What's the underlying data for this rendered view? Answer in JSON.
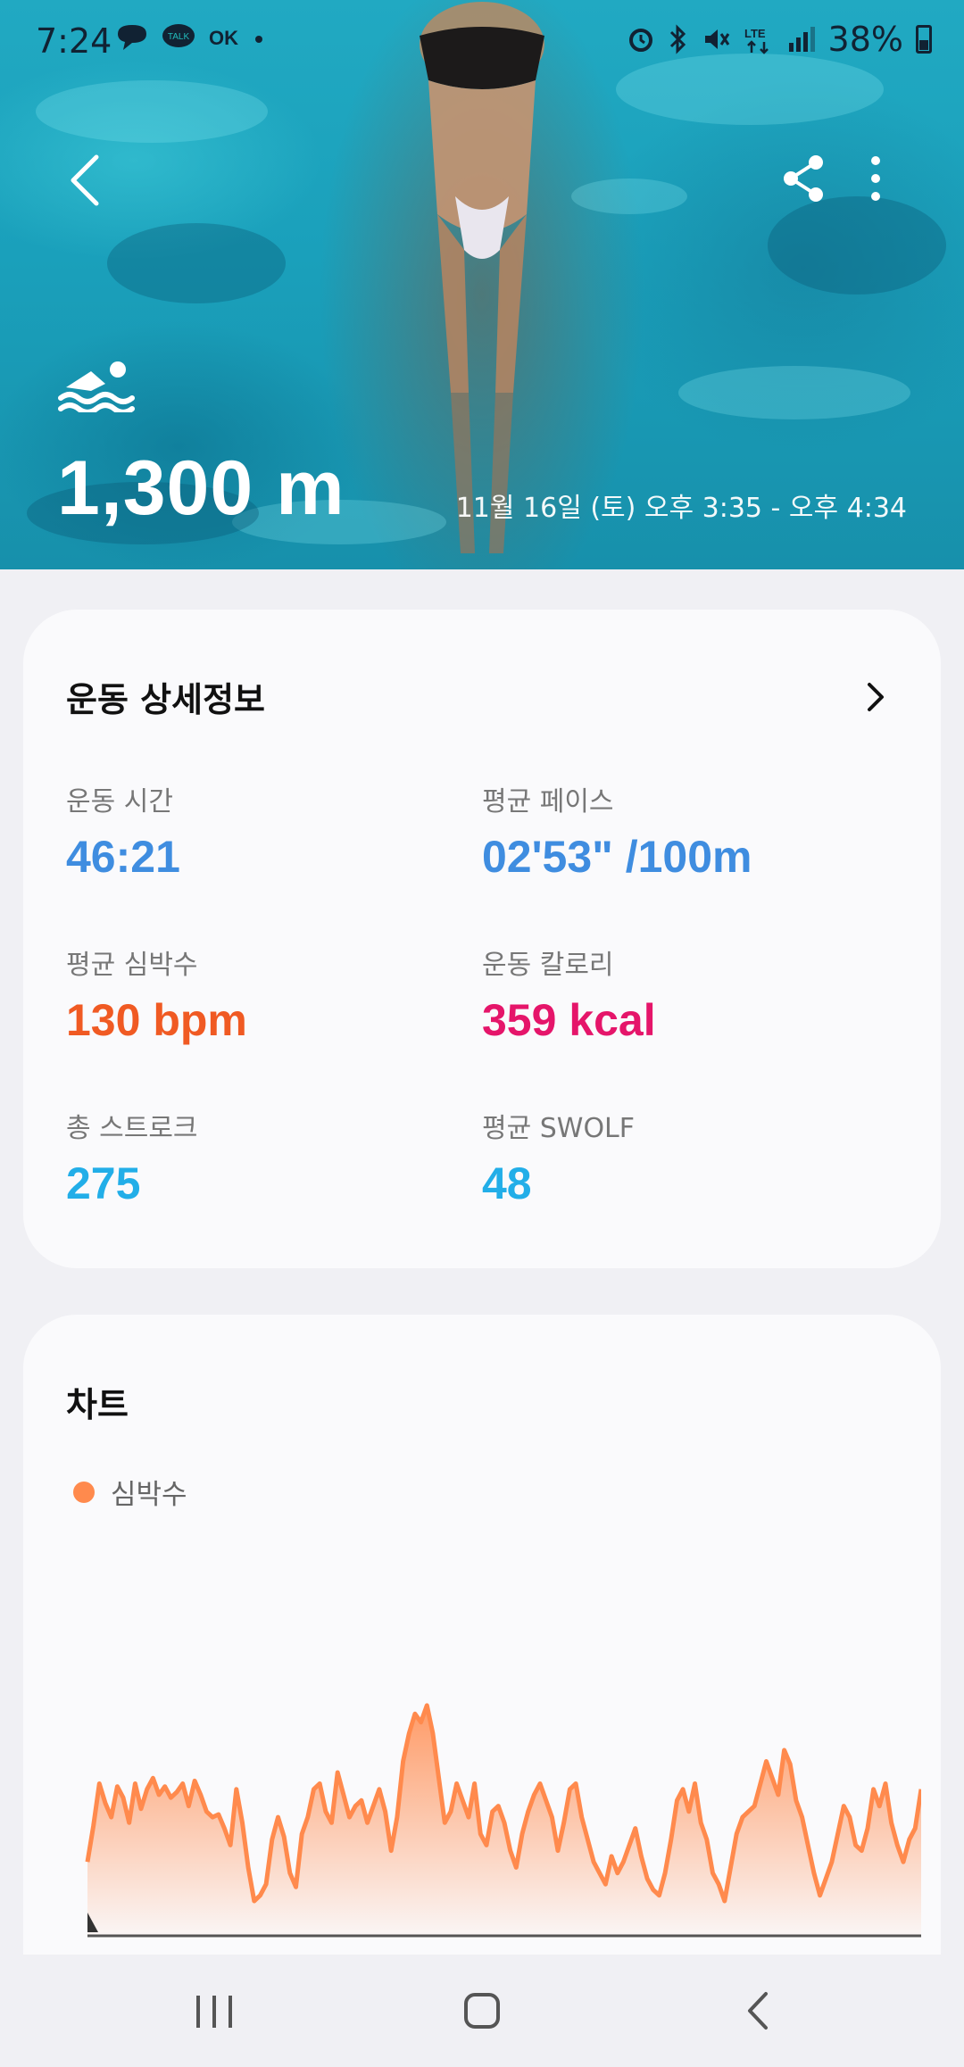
{
  "status_bar": {
    "time": "7:24",
    "left_icons": [
      "chat-bubble-icon",
      "talk-icon",
      "ok-icon",
      "dot-icon"
    ],
    "right_icons": [
      "alarm-icon",
      "bluetooth-icon",
      "mute-icon",
      "lte-icon",
      "signal-icon"
    ],
    "battery_text": "38%"
  },
  "header": {
    "distance": "1,300 m",
    "date_range": "11월 16일 (토) 오후 3:35 - 오후 4:34",
    "activity_icon": "swimming-icon"
  },
  "details": {
    "title": "운동 상세정보",
    "metrics": [
      {
        "label": "운동 시간",
        "value": "46:21",
        "color": "#3f8de0"
      },
      {
        "label": "평균 페이스",
        "value": "02'53\" /100m",
        "color": "#3f8de0"
      },
      {
        "label": "평균 심박수",
        "value": "130 bpm",
        "color": "#f05a23"
      },
      {
        "label": "운동 칼로리",
        "value": "359 kcal",
        "color": "#e5156a"
      },
      {
        "label": "총 스트로크",
        "value": "275",
        "color": "#22aee8"
      },
      {
        "label": "평균 SWOLF",
        "value": "48",
        "color": "#22aee8"
      }
    ]
  },
  "chart_section": {
    "title": "차트",
    "legend_label": "심박수",
    "accent": "#ff8a4d"
  },
  "chart_data": {
    "type": "area",
    "title": "",
    "series": [
      {
        "name": "심박수",
        "values": [
          112,
          125,
          140,
          133,
          128,
          139,
          135,
          126,
          140,
          131,
          138,
          142,
          136,
          139,
          135,
          137,
          140,
          132,
          141,
          136,
          130,
          128,
          129,
          124,
          118,
          138,
          126,
          110,
          98,
          100,
          104,
          120,
          128,
          121,
          108,
          103,
          122,
          128,
          138,
          140,
          130,
          126,
          144,
          136,
          128,
          132,
          134,
          126,
          132,
          138,
          130,
          116,
          128,
          148,
          158,
          165,
          162,
          168,
          158,
          142,
          126,
          130,
          140,
          134,
          128,
          140,
          122,
          118,
          130,
          132,
          126,
          116,
          110,
          122,
          130,
          136,
          140,
          134,
          128,
          116,
          126,
          138,
          140,
          128,
          120,
          112,
          108,
          104,
          114,
          108,
          112,
          118,
          124,
          114,
          106,
          102,
          100,
          108,
          120,
          134,
          138,
          130,
          140,
          126,
          120,
          108,
          104,
          98,
          110,
          122,
          128,
          130,
          132,
          140,
          148,
          142,
          136,
          152,
          147,
          134,
          128,
          118,
          108,
          100,
          106,
          112,
          122,
          132,
          128,
          118,
          116,
          124,
          138,
          132,
          140,
          126,
          118,
          112,
          120,
          124,
          138
        ]
      }
    ],
    "ylim": [
      90,
      175
    ],
    "grid": false,
    "legend": "top-left"
  },
  "nav": {
    "recent_icon": "recent-apps-icon",
    "home_icon": "home-icon",
    "back_icon": "back-icon"
  }
}
